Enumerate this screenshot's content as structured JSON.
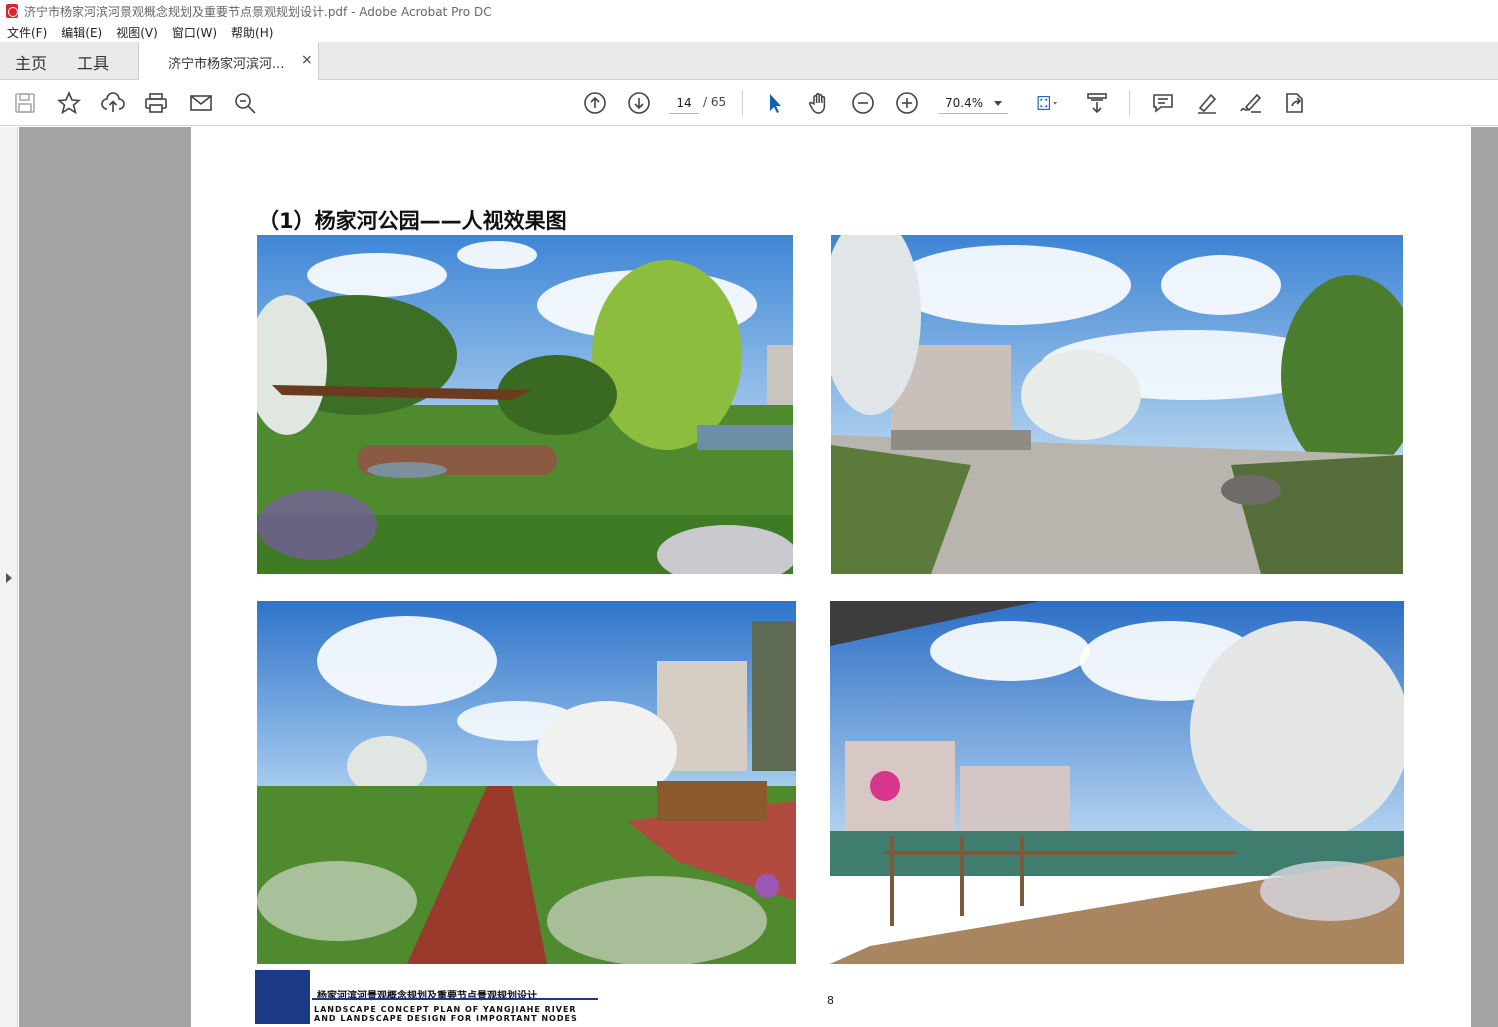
{
  "window": {
    "title": "济宁市杨家河滨河景观概念规划及重要节点景观规划设计.pdf - Adobe Acrobat Pro DC"
  },
  "menu": {
    "items": [
      "文件(F)",
      "编辑(E)",
      "视图(V)",
      "窗口(W)",
      "帮助(H)"
    ]
  },
  "tabs": {
    "home": "主页",
    "tools": "工具",
    "doc": "济宁市杨家河滨河...",
    "close": "×"
  },
  "toolbar": {
    "icons": [
      "save-icon",
      "bookmark-star-icon",
      "upload-cloud-icon",
      "print-icon",
      "email-icon",
      "zoom-search-icon",
      "page-up-icon",
      "page-down-icon",
      "select-cursor-icon",
      "hand-icon",
      "zoom-out-icon",
      "zoom-in-icon",
      "fit-page-icon",
      "scroll-mode-icon",
      "comment-icon",
      "highlight-icon",
      "sign-icon",
      "share-icon"
    ],
    "page_current": "14",
    "page_total": "/ 65",
    "zoom": "70.4%"
  },
  "document": {
    "heading": "（1）杨家河公园——人视效果图",
    "page_number": "8",
    "footer_cn": "杨家河滨河景观概念规划及重要节点景观规划设计",
    "footer_en_1": "LANDSCAPE CONCEPT PLAN OF YANGJIAHE RIVER",
    "footer_en_2": "AND LANDSCAPE DESIGN FOR IMPORTANT NODES"
  },
  "colors": {
    "accent_blue": "#1c3a86",
    "workspace_gray": "#a3a3a3",
    "sky": "#5d9be0",
    "grass": "#4f8a2e"
  }
}
